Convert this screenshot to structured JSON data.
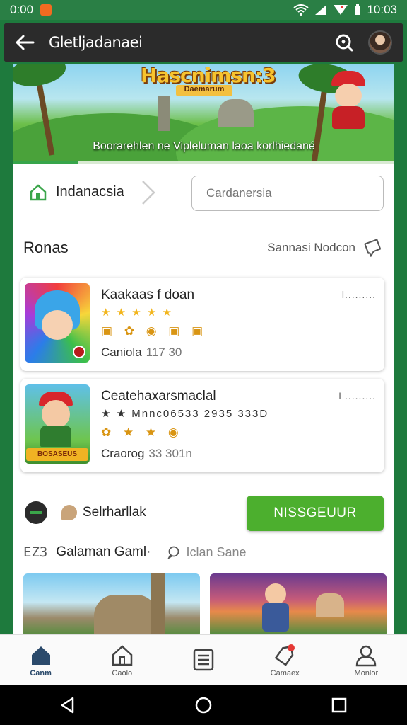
{
  "status_bar": {
    "time": "0:00",
    "clock": "10:03"
  },
  "app_bar": {
    "title": "Gletljadanaei"
  },
  "banner": {
    "logo": "Hascnimsn:3",
    "logo_sub": "Daemarum",
    "tagline": "Boorarehlen ne Vipleluman laoa korlhiedané",
    "progress": 0.17
  },
  "location": {
    "label": "Indanacsia"
  },
  "search": {
    "placeholder": "Cardanersia"
  },
  "section": {
    "title": "Ronas",
    "action_label": "Sannasi Nodcon"
  },
  "cards": [
    {
      "name": "Kaakaas f doan",
      "menu": "l.........",
      "stars": "★ ★ ★ ★ ★",
      "badges": "▣ ✿ ◉ ▣ ▣",
      "meta_label": "Caniola",
      "meta_value": "117 30"
    },
    {
      "name": "Ceatehaxarsmaclal",
      "menu": "L.........",
      "stars": "★ ★ Mnnc06533 2935 333D",
      "badges": "✿ ★ ★ ◉",
      "meta_label": "Craorog",
      "meta_value": "33 301n",
      "thumb_label": "BOSASEUS"
    }
  ],
  "action": {
    "label": "Selrharllak",
    "cta": "NISSGEUUR"
  },
  "category": {
    "code": "EZ3",
    "name": "Galaman Gaml·",
    "sub": "Iclan Sane"
  },
  "bottom_nav": [
    {
      "label": "Canm",
      "icon": "home-icon",
      "active": true
    },
    {
      "label": "Caolo",
      "icon": "house-outline-icon",
      "active": false
    },
    {
      "label": "",
      "icon": "list-icon",
      "active": false
    },
    {
      "label": "Camaex",
      "icon": "tag-icon",
      "active": false
    },
    {
      "label": "Monlor",
      "icon": "profile-icon",
      "active": false
    }
  ],
  "colors": {
    "brand_green": "#4caf2e",
    "status_bar": "#2a7f45",
    "app_bar": "#2b2b2b"
  }
}
